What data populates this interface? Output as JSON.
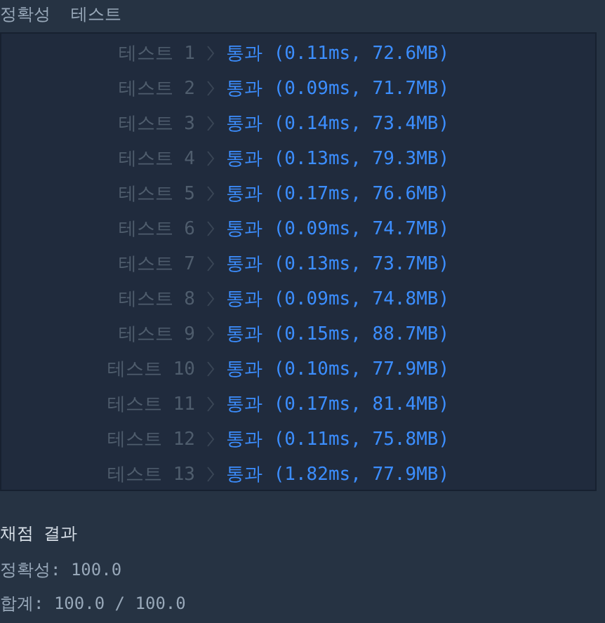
{
  "heading": "정확성  테스트",
  "tests": [
    {
      "label": "테스트 1",
      "kind": "pass",
      "result": "통과 (0.11ms, 72.6MB)"
    },
    {
      "label": "테스트 2",
      "kind": "pass",
      "result": "통과 (0.09ms, 71.7MB)"
    },
    {
      "label": "테스트 3",
      "kind": "pass",
      "result": "통과 (0.14ms, 73.4MB)"
    },
    {
      "label": "테스트 4",
      "kind": "pass",
      "result": "통과 (0.13ms, 79.3MB)"
    },
    {
      "label": "테스트 5",
      "kind": "pass",
      "result": "통과 (0.17ms, 76.6MB)"
    },
    {
      "label": "테스트 6",
      "kind": "pass",
      "result": "통과 (0.09ms, 74.7MB)"
    },
    {
      "label": "테스트 7",
      "kind": "pass",
      "result": "통과 (0.13ms, 73.7MB)"
    },
    {
      "label": "테스트 8",
      "kind": "pass",
      "result": "통과 (0.09ms, 74.8MB)"
    },
    {
      "label": "테스트 9",
      "kind": "pass",
      "result": "통과 (0.15ms, 88.7MB)"
    },
    {
      "label": "테스트 10",
      "kind": "pass",
      "result": "통과 (0.10ms, 77.9MB)"
    },
    {
      "label": "테스트 11",
      "kind": "pass",
      "result": "통과 (0.17ms, 81.4MB)"
    },
    {
      "label": "테스트 12",
      "kind": "pass",
      "result": "통과 (0.11ms, 75.8MB)"
    },
    {
      "label": "테스트 13",
      "kind": "pass",
      "result": "통과 (1.82ms, 77.9MB)"
    }
  ],
  "summary": {
    "title": "채점 결과",
    "lines": [
      "정확성: 100.0",
      "합계: 100.0 / 100.0"
    ]
  }
}
